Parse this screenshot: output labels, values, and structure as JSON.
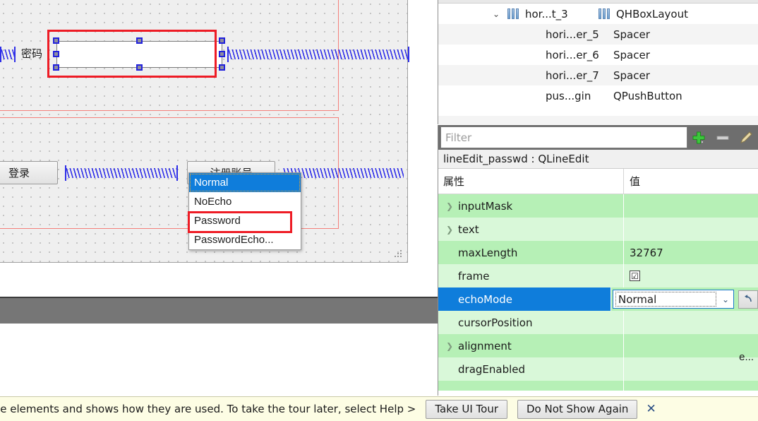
{
  "designer": {
    "label_passwd": "密码",
    "btn_login": "登录",
    "btn_register": "注册账号",
    "selected_widget": "lineEdit_passwd",
    "annotation_color": "#ee1c25",
    "selection_handle_color": "#2222dd",
    "layout_outline_color": "#f4807a",
    "spacer_color": "#2424e8",
    "canvas_bg": "#efefef",
    "gray_bar_color": "#767676"
  },
  "inspector": {
    "rows": [
      {
        "name": "hor...t_3",
        "class": "QHBoxLayout",
        "twisty": "⌄",
        "icon": "layout-icon",
        "indent": false
      },
      {
        "name": "hori...er_5",
        "class": "Spacer",
        "twisty": "",
        "icon": "",
        "indent": true
      },
      {
        "name": "hori...er_6",
        "class": "Spacer",
        "twisty": "",
        "icon": "",
        "indent": true
      },
      {
        "name": "hori...er_7",
        "class": "Spacer",
        "twisty": "",
        "icon": "",
        "indent": true
      },
      {
        "name": "pus...gin",
        "class": "QPushButton",
        "twisty": "",
        "icon": "",
        "indent": true
      }
    ]
  },
  "filter": {
    "placeholder": "Filter",
    "value": "",
    "add_label": "+",
    "remove_label": "−",
    "add_color": "#3cc63c",
    "remove_color": "#d0d0d0"
  },
  "property_editor": {
    "object_header": "lineEdit_passwd : QLineEdit",
    "col_property": "属性",
    "col_value": "值",
    "rows": [
      {
        "name": "inputMask",
        "value": "",
        "expandable": true,
        "shade": "A",
        "selected": false,
        "kind": "text"
      },
      {
        "name": "text",
        "value": "",
        "expandable": true,
        "shade": "B",
        "selected": false,
        "kind": "text"
      },
      {
        "name": "maxLength",
        "value": "32767",
        "expandable": false,
        "shade": "A",
        "selected": false,
        "kind": "text"
      },
      {
        "name": "frame",
        "value": "☑",
        "expandable": false,
        "shade": "B",
        "selected": false,
        "kind": "checkbox"
      },
      {
        "name": "echoMode",
        "value": "Normal",
        "expandable": false,
        "shade": "A",
        "selected": true,
        "kind": "combo"
      },
      {
        "name": "cursorPosition",
        "value": "",
        "expandable": false,
        "shade": "B",
        "selected": false,
        "kind": "text"
      },
      {
        "name": "alignment",
        "value": "",
        "expandable": true,
        "shade": "A",
        "selected": false,
        "kind": "text"
      },
      {
        "name": "dragEnabled",
        "value": "",
        "expandable": false,
        "shade": "B",
        "selected": false,
        "kind": "text"
      }
    ],
    "alignment_ghost_value": "e...",
    "selected_row_color": "#0f7ddb",
    "shade_a_color": "#b6f0b6",
    "shade_b_color": "#d9f8d9"
  },
  "echo_dropdown": {
    "current": "Normal",
    "annotated": "Password",
    "options": [
      "Normal",
      "NoEcho",
      "Password",
      "PasswordEcho..."
    ]
  },
  "tour_bar": {
    "message": "ce elements and shows how they are used. To take the tour later, select Help >",
    "take_tour": "Take UI Tour",
    "do_not_show": "Do Not Show Again",
    "close": "✕",
    "bg_color": "#fdfde4"
  }
}
